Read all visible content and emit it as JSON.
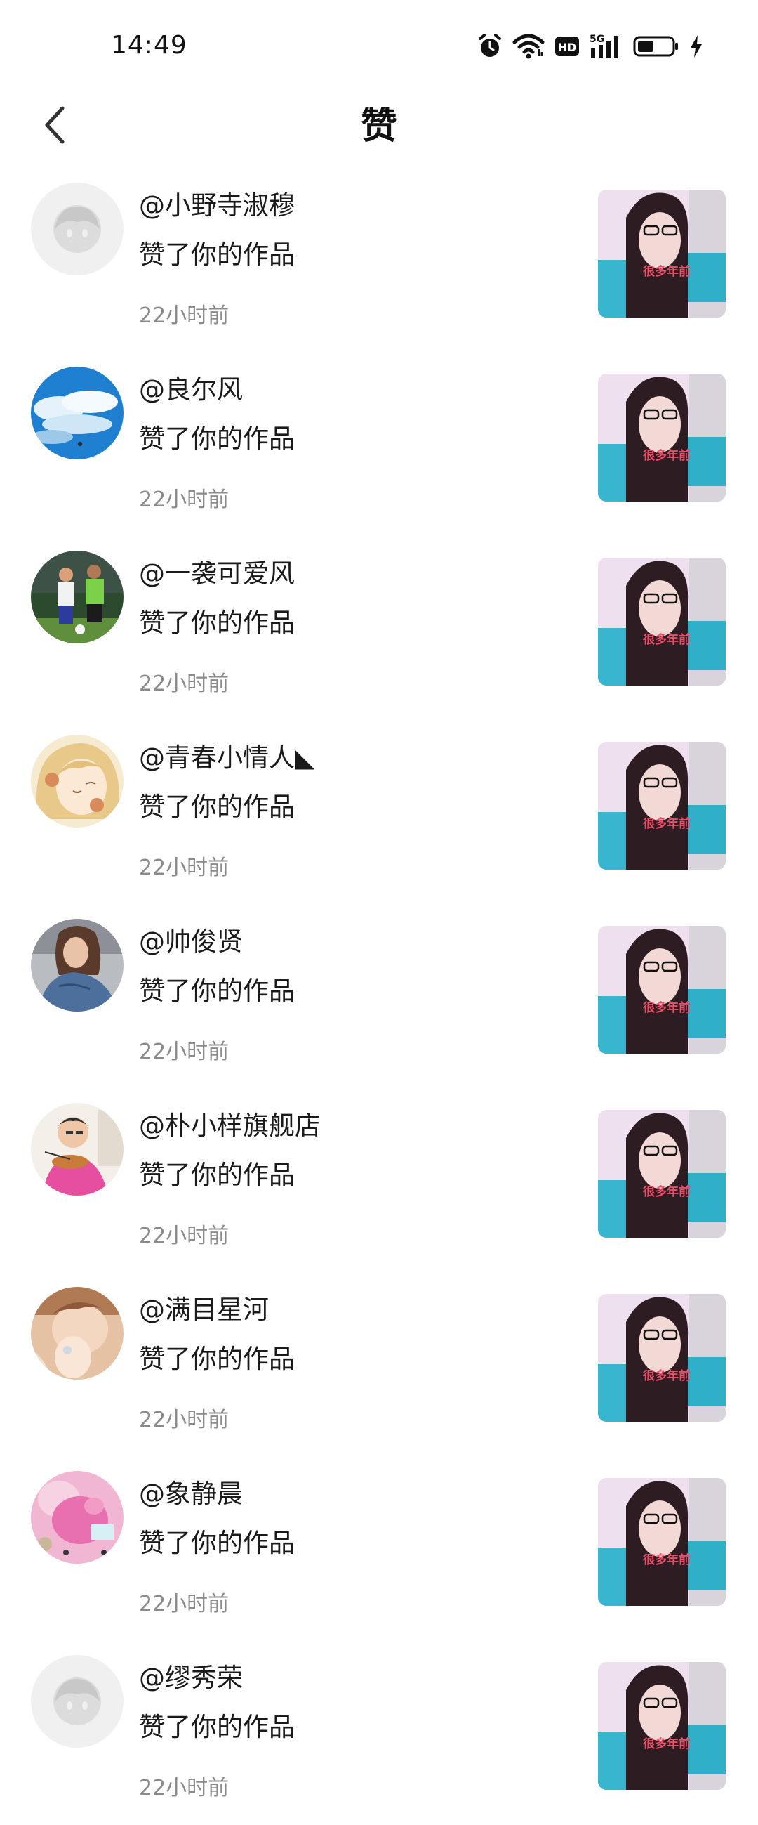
{
  "status_bar": {
    "time": "14:49",
    "icons": [
      "alarm-icon",
      "wifi-icon",
      "hd-icon",
      "signal-5g-icon",
      "battery-icon",
      "charging-icon"
    ]
  },
  "header": {
    "title": "赞",
    "back_icon": "chevron-left-icon"
  },
  "likes": [
    {
      "username": "@小野寺淑穆",
      "action": "赞了你的作品",
      "time": "22小时前",
      "avatar": "default-avatar"
    },
    {
      "username": "@良尔风",
      "action": "赞了你的作品",
      "time": "22小时前",
      "avatar": "sky-clouds"
    },
    {
      "username": "@一袭可爱风",
      "action": "赞了你的作品",
      "time": "22小时前",
      "avatar": "football-players"
    },
    {
      "username": "@青春小情人◣",
      "action": "赞了你的作品",
      "time": "22小时前",
      "avatar": "anime-girl"
    },
    {
      "username": "@帅俊贤",
      "action": "赞了你的作品",
      "time": "22小时前",
      "avatar": "woman-denim"
    },
    {
      "username": "@朴小样旗舰店",
      "action": "赞了你的作品",
      "time": "22小时前",
      "avatar": "man-with-food"
    },
    {
      "username": "@满目星河",
      "action": "赞了你的作品",
      "time": "22小时前",
      "avatar": "woman-hand"
    },
    {
      "username": "@象静晨",
      "action": "赞了你的作品",
      "time": "22小时前",
      "avatar": "pink-toy"
    },
    {
      "username": "@缪秀荣",
      "action": "赞了你的作品",
      "time": "22小时前",
      "avatar": "default-avatar"
    }
  ],
  "thumbnail_caption": "很多年前",
  "colors": {
    "username": "#1a1a1a",
    "time": "#8a8a8a",
    "thumb_bg": "#efe0ef",
    "thumb_caption": "#e8506a"
  }
}
